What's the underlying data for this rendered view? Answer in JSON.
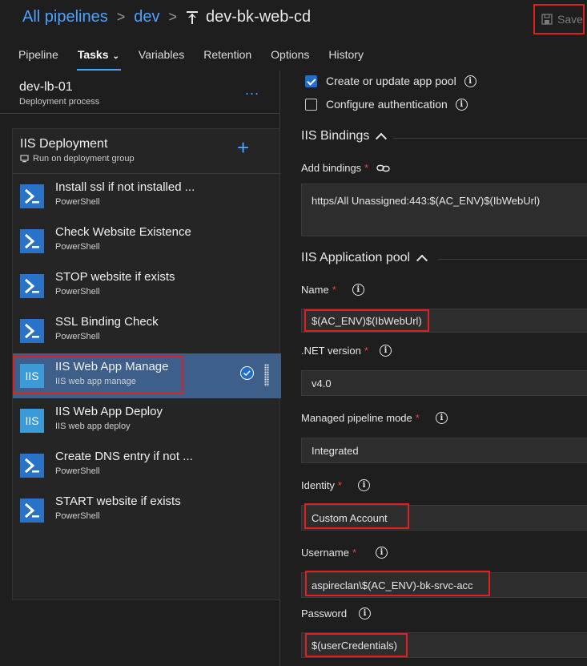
{
  "header": {
    "breadcrumb": [
      "All pipelines",
      "dev"
    ],
    "separator": ">",
    "current": "dev-bk-web-cd",
    "save_label": "Save"
  },
  "tabs": [
    {
      "label": "Pipeline"
    },
    {
      "label": "Tasks"
    },
    {
      "label": "Variables"
    },
    {
      "label": "Retention"
    },
    {
      "label": "Options"
    },
    {
      "label": "History"
    }
  ],
  "stage": {
    "name": "dev-lb-01",
    "subtitle": "Deployment process",
    "more": "..."
  },
  "phase": {
    "title": "IIS Deployment",
    "subtitle": "Run on deployment group",
    "add": "+"
  },
  "tasks": [
    {
      "title": "Install ssl if not installed ...",
      "subtitle": "PowerShell",
      "icon": "powershell-icon"
    },
    {
      "title": "Check Website Existence",
      "subtitle": "PowerShell",
      "icon": "powershell-icon"
    },
    {
      "title": "STOP website if exists",
      "subtitle": "PowerShell",
      "icon": "powershell-icon"
    },
    {
      "title": "SSL Binding Check",
      "subtitle": "PowerShell",
      "icon": "powershell-icon"
    },
    {
      "title": "IIS Web App Manage",
      "subtitle": "IIS web app manage",
      "icon": "iis-icon",
      "selected": true
    },
    {
      "title": "IIS Web App Deploy",
      "subtitle": "IIS web app deploy",
      "icon": "iis-icon"
    },
    {
      "title": "Create DNS entry if not ...",
      "subtitle": "PowerShell",
      "icon": "powershell-icon"
    },
    {
      "title": "START website if exists",
      "subtitle": "PowerShell",
      "icon": "powershell-icon"
    }
  ],
  "iis_icon_text": "IIS",
  "options": {
    "create_app_pool": {
      "label": "Create or update app pool",
      "checked": true
    },
    "configure_auth": {
      "label": "Configure authentication",
      "checked": false
    }
  },
  "bindings": {
    "section_title": "IIS Bindings",
    "add_label": "Add bindings",
    "value": "https/All Unassigned:443:$(AC_ENV)$(IbWebUrl)"
  },
  "app_pool": {
    "section_title": "IIS Application pool",
    "name_label": "Name",
    "name_value": "$(AC_ENV)$(IbWebUrl)",
    "net_label": ".NET version",
    "net_value": "v4.0",
    "mode_label": "Managed pipeline mode",
    "mode_value": "Integrated",
    "identity_label": "Identity",
    "identity_value": "Custom Account",
    "username_label": "Username",
    "username_value": "aspireclan\\$(AC_ENV)-bk-srvc-acc",
    "password_label": "Password",
    "password_value": "$(userCredentials)"
  },
  "required_mark": "*",
  "info_glyph": "i",
  "colors": {
    "accent": "#4da3ff",
    "highlight": "#e02020",
    "selected_row": "#3e5f8a",
    "required": "#e84545"
  }
}
